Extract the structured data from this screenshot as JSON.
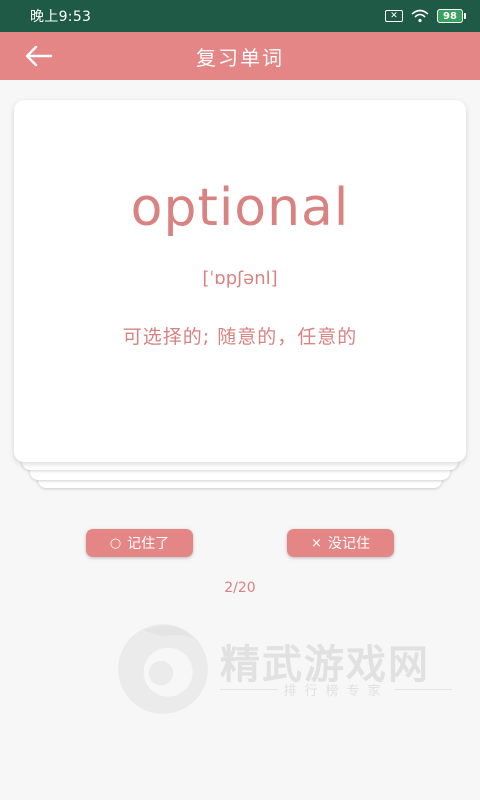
{
  "status_bar": {
    "time": "晚上9:53",
    "battery": "98",
    "sim_icon": "sim-off-icon",
    "wifi_icon": "wifi-icon"
  },
  "app_bar": {
    "title": "复习单词",
    "back_icon": "arrow-left-icon"
  },
  "card": {
    "word": "optional",
    "phonetic": "[ˈɒpʃənl]",
    "meaning": "可选择的; 随意的，任意的"
  },
  "actions": {
    "remembered_icon": "○",
    "remembered_label": "记住了",
    "forgot_icon": "×",
    "forgot_label": "没记住"
  },
  "progress": "2/20",
  "watermark": {
    "name": "精武游戏网",
    "slogan": "排行榜专家"
  },
  "colors": {
    "accent": "#e48686",
    "text_accent": "#d98282",
    "status_bar": "#1f5a46"
  }
}
